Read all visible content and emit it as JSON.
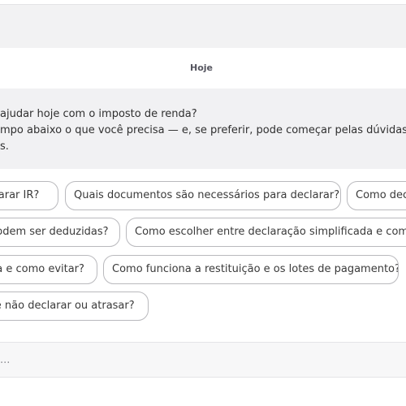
{
  "header": {},
  "chat": {
    "date_label": "Hoje",
    "message": {
      "lines": [
        " ajudar hoje com o imposto de renda?",
        "mpo abaixo o que você precisa — e, se preferir, pode começar pelas dúvidas",
        "s."
      ]
    },
    "suggestions": [
      "clarar IR?",
      "Quais documentos são necessários para declarar?",
      "Como dec",
      "podem ser deduzidas?",
      "Como escolher entre declaração simplificada e comp",
      "na e como evitar?",
      "Como funciona a restituição e os lotes de pagamento?",
      "se não declarar ou atrasar?"
    ]
  },
  "composer": {
    "placeholder": "..."
  }
}
